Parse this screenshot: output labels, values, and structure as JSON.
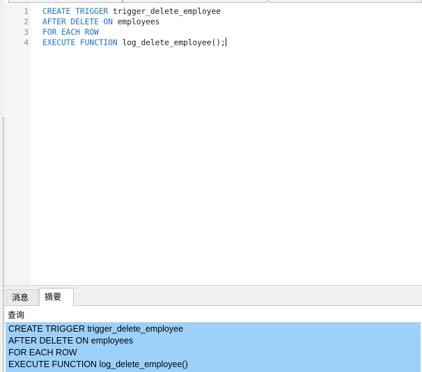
{
  "editor": {
    "lines": [
      {
        "number": "1",
        "keyword": "CREATE TRIGGER",
        "rest": " trigger_delete_employee"
      },
      {
        "number": "2",
        "keyword": "AFTER DELETE ON",
        "rest": " employees"
      },
      {
        "number": "3",
        "keyword": "FOR EACH ROW",
        "rest": ""
      },
      {
        "number": "4",
        "keyword": "EXECUTE FUNCTION",
        "rest": " log_delete_employee();"
      }
    ]
  },
  "bottom_panel": {
    "tabs": [
      {
        "label": "消息"
      },
      {
        "label": "摘要"
      }
    ],
    "active_tab": "摘要",
    "result_column": "查询",
    "result_lines": [
      "CREATE TRIGGER trigger_delete_employee",
      "AFTER DELETE ON employees",
      "FOR EACH ROW",
      "EXECUTE FUNCTION log_delete_employee()"
    ]
  },
  "colors": {
    "keyword": "#1e73c8",
    "selection": "#9dd0fb",
    "gutter": "#f5f5f5"
  }
}
